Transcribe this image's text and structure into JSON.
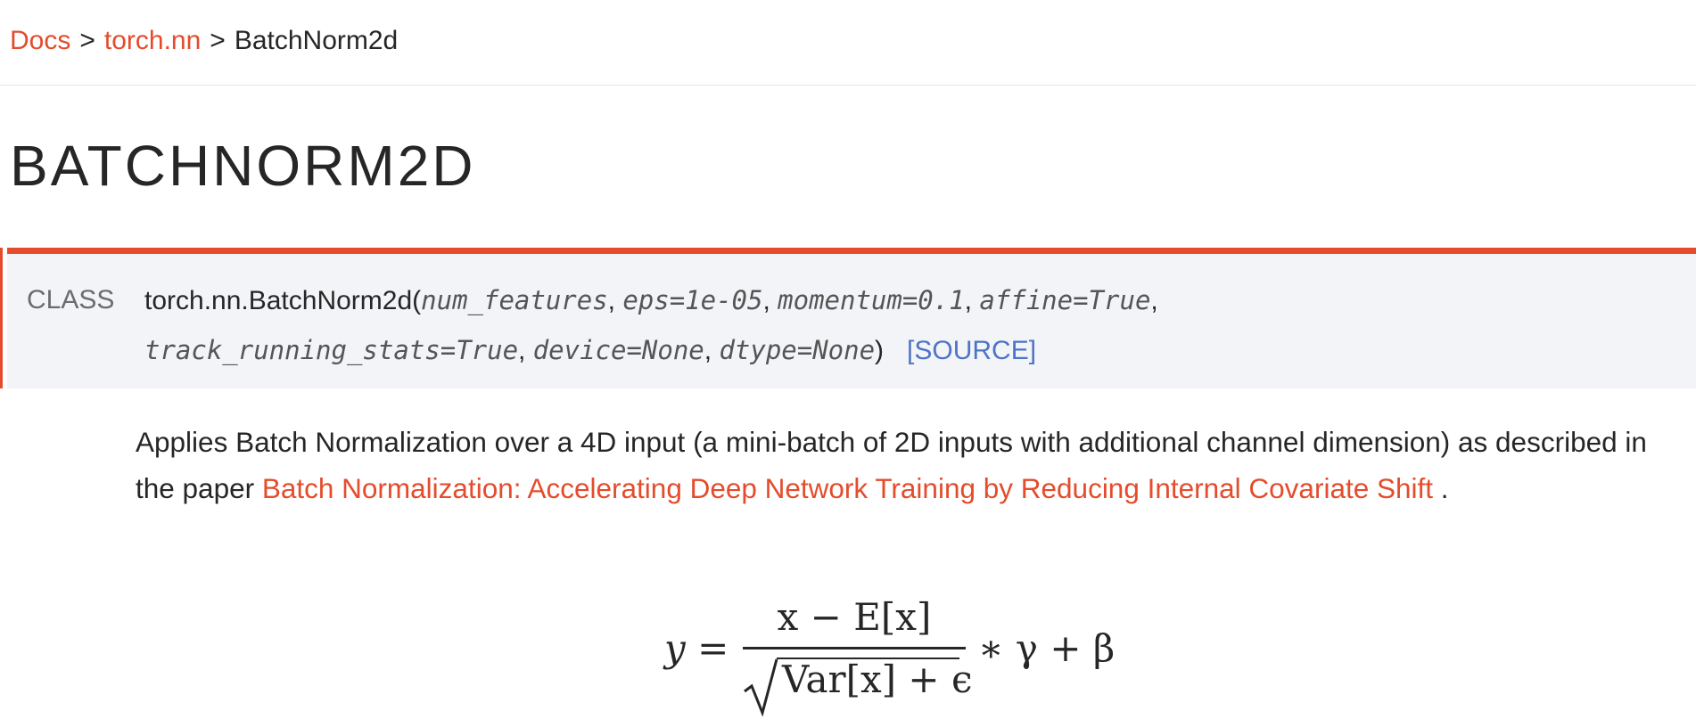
{
  "breadcrumb": {
    "items": [
      "Docs",
      "torch.nn"
    ],
    "separator": ">",
    "current": "BatchNorm2d"
  },
  "title": "BATCHNORM2D",
  "signature": {
    "keyword": "CLASS",
    "name": "torch.nn.BatchNorm2d",
    "open_paren": "(",
    "close_paren": ")",
    "params_line1": [
      "num_features",
      "eps=1e-05",
      "momentum=0.1",
      "affine=True"
    ],
    "params_line2": [
      "track_running_stats=True",
      "device=None",
      "dtype=None"
    ],
    "source_label": "[SOURCE]"
  },
  "description": {
    "text_before": "Applies Batch Normalization over a 4D input (a mini-batch of 2D inputs with additional channel dimension) as described in the paper ",
    "link_text": "Batch Normalization: Accelerating Deep Network Training by Reducing Internal Covariate Shift",
    "text_after": " ."
  },
  "formula": {
    "lhs": "y =",
    "numerator": "x − E[x]",
    "denominator": "Var[x] + ϵ",
    "rhs": "∗ γ + β"
  },
  "colors": {
    "accent": "#e44c2c",
    "source_link": "#4e74c7",
    "signature_bg": "#f3f4f7",
    "text": "#262626"
  }
}
